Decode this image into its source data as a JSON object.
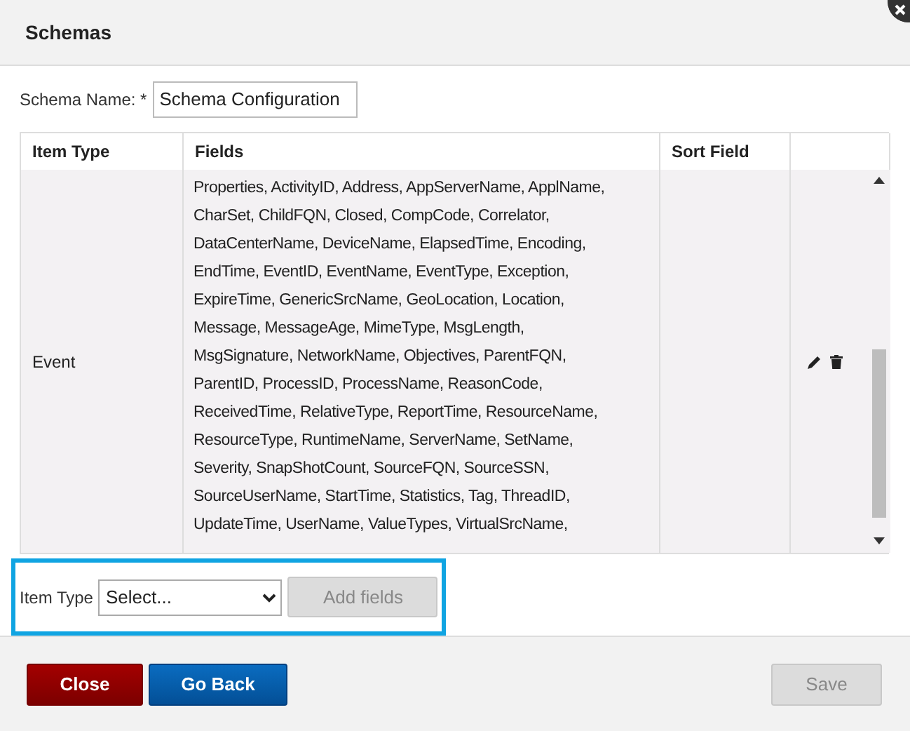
{
  "dialog": {
    "title": "Schemas"
  },
  "schema_name": {
    "label": "Schema Name: *",
    "value": "Schema Configuration"
  },
  "table": {
    "columns": [
      "Item Type",
      "Fields",
      "Sort Field"
    ],
    "rows": [
      {
        "item_type": "Event",
        "fields": [
          "Properties, ActivityID, Address, AppServerName, ApplName,",
          "CharSet, ChildFQN, Closed, CompCode, Correlator,",
          "DataCenterName, DeviceName, ElapsedTime, Encoding,",
          "EndTime, EventID, EventName, EventType, Exception,",
          "ExpireTime, GenericSrcName, GeoLocation, Location,",
          "Message, MessageAge, MimeType, MsgLength,",
          "MsgSignature, NetworkName, Objectives, ParentFQN,",
          "ParentID, ProcessID, ProcessName, ReasonCode,",
          "ReceivedTime, RelativeType, ReportTime, ResourceName,",
          "ResourceType, RuntimeName, ServerName, SetName,",
          "Severity, SnapShotCount, SourceFQN, SourceSSN,",
          "SourceUserName, StartTime, Statistics, Tag, ThreadID,",
          "UpdateTime, UserName, ValueTypes, VirtualSrcName,"
        ]
      }
    ]
  },
  "add_section": {
    "label": "Item Type",
    "select_value": "Select...",
    "button": {
      "label": "Add fields",
      "disabled": true
    }
  },
  "footer": {
    "buttons": [
      {
        "label": "Close",
        "kind": "danger",
        "disabled": false
      },
      {
        "label": "Go Back",
        "kind": "primary",
        "disabled": false
      },
      {
        "label": "Save",
        "kind": "default",
        "disabled": true
      }
    ]
  }
}
